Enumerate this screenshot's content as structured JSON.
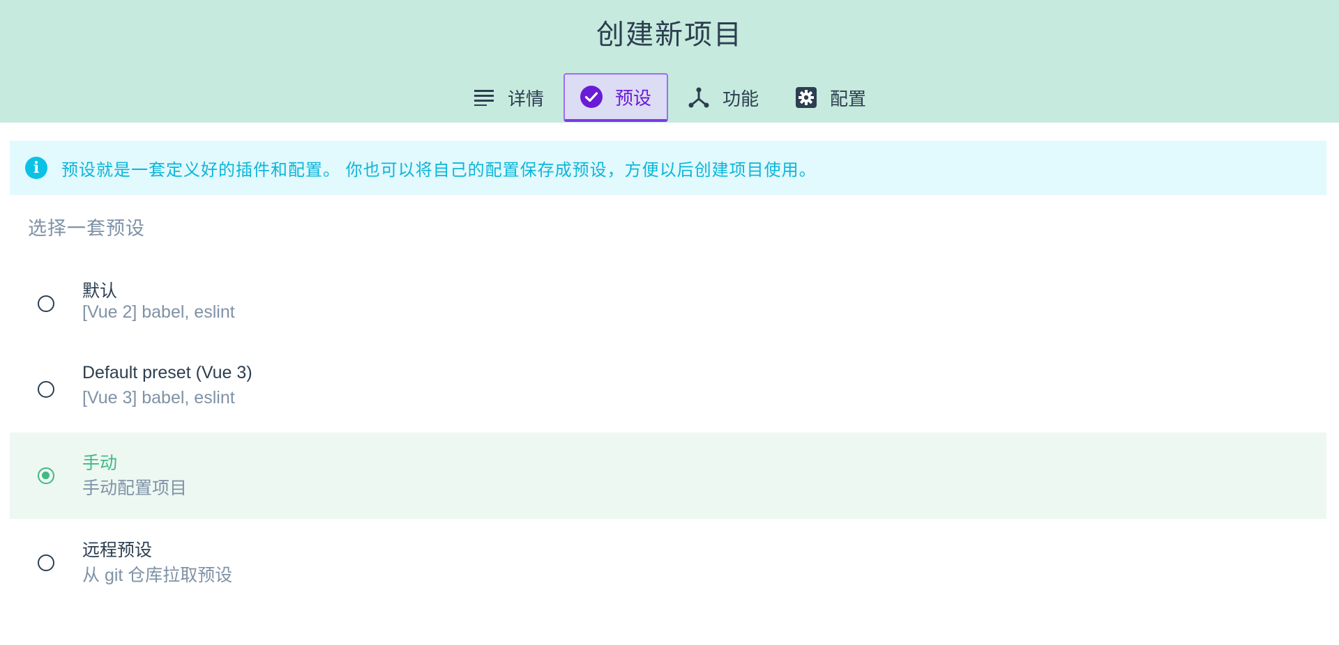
{
  "page": {
    "title": "创建新项目"
  },
  "tabs": [
    {
      "label": "详情",
      "icon": "list-lines-icon",
      "active": false
    },
    {
      "label": "预设",
      "icon": "check-circle-icon",
      "active": true
    },
    {
      "label": "功能",
      "icon": "fork-icon",
      "active": false
    },
    {
      "label": "配置",
      "icon": "gear-square-icon",
      "active": false
    }
  ],
  "info": {
    "icon": "info-icon",
    "text": "预设就是一套定义好的插件和配置。 你也可以将自己的配置保存成预设，方便以后创建项目使用。"
  },
  "section": {
    "label": "选择一套预设"
  },
  "presets": [
    {
      "name": "默认",
      "description": "[Vue 2] babel, eslint",
      "selected": false
    },
    {
      "name": "Default preset (Vue 3)",
      "description": "[Vue 3] babel, eslint",
      "selected": false
    },
    {
      "name": "手动",
      "description": "手动配置项目",
      "selected": true
    },
    {
      "name": "远程预设",
      "description": "从 git 仓库拉取预设",
      "selected": false
    }
  ],
  "colors": {
    "header_bg": "#c6eadd",
    "accent_green": "#42b883",
    "active_tab_purple": "#6a1bd6",
    "info_cyan": "#0bc2e5",
    "text_dark": "#2c3e50",
    "text_muted": "#7f92a6"
  }
}
